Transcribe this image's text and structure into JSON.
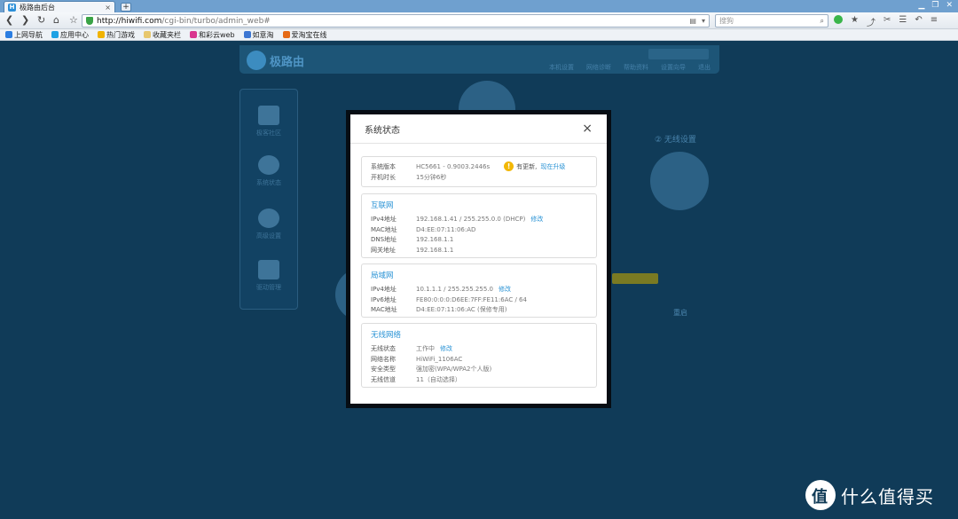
{
  "browser": {
    "tab_title": "极路由后台",
    "tab_close": "×",
    "new_tab": "+",
    "url_host": "http://hiwifi.com",
    "url_path": "/cgi-bin/turbo/admin_web#",
    "search_placeholder": "搜狗",
    "bookmarks": [
      "上网导航",
      "应用中心",
      "热门游戏",
      "收藏夹栏",
      "和彩云web",
      "如意淘",
      "爱淘宝在线"
    ]
  },
  "modal": {
    "title": "系统状态",
    "close": "×",
    "system": {
      "version_label": "系统版本",
      "version_value": "HC5661 - 0.9003.2446s",
      "update_text": "有更新,",
      "update_action": "现在升级",
      "uptime_label": "开机时长",
      "uptime_value": "15分钟6秒"
    },
    "internet": {
      "title": "互联网",
      "rows": [
        {
          "label": "IPv4地址",
          "value": "192.168.1.41 / 255.255.0.0 (DHCP)",
          "action": "修改"
        },
        {
          "label": "MAC地址",
          "value": "D4:EE:07:11:06:AD",
          "action": ""
        },
        {
          "label": "DNS地址",
          "value": "192.168.1.1",
          "action": ""
        },
        {
          "label": "网关地址",
          "value": "192.168.1.1",
          "action": ""
        }
      ]
    },
    "lan": {
      "title": "局域网",
      "rows": [
        {
          "label": "IPv4地址",
          "value": "10.1.1.1 / 255.255.255.0",
          "action": "修改"
        },
        {
          "label": "IPv6地址",
          "value": "FE80:0:0:0:D6EE:7FF:FE11:6AC / 64",
          "action": ""
        },
        {
          "label": "MAC地址",
          "value": "D4:EE:07:11:06:AC (保修专用)",
          "action": ""
        }
      ]
    },
    "wireless": {
      "title": "无线网络",
      "rows": [
        {
          "label": "无线状态",
          "value": "工作中",
          "action": "修改"
        },
        {
          "label": "网络名称",
          "value": "HiWiFi_1106AC",
          "action": ""
        },
        {
          "label": "安全类型",
          "value": "强加密(WPA/WPA2个人版)",
          "action": ""
        },
        {
          "label": "无线信道",
          "value": "11（自动选择）",
          "action": ""
        }
      ]
    }
  },
  "background": {
    "logo_text": "极路由",
    "sidebar": [
      "极客社区",
      "系统状态",
      "高级设置",
      "驱动管理"
    ],
    "header_links": [
      "本机设置",
      "网络诊断",
      "帮助资料",
      "设置向导",
      "退出"
    ],
    "step2": "② 无线设置",
    "restart": "重启"
  },
  "watermark": {
    "icon": "值",
    "text": "什么值得买"
  }
}
